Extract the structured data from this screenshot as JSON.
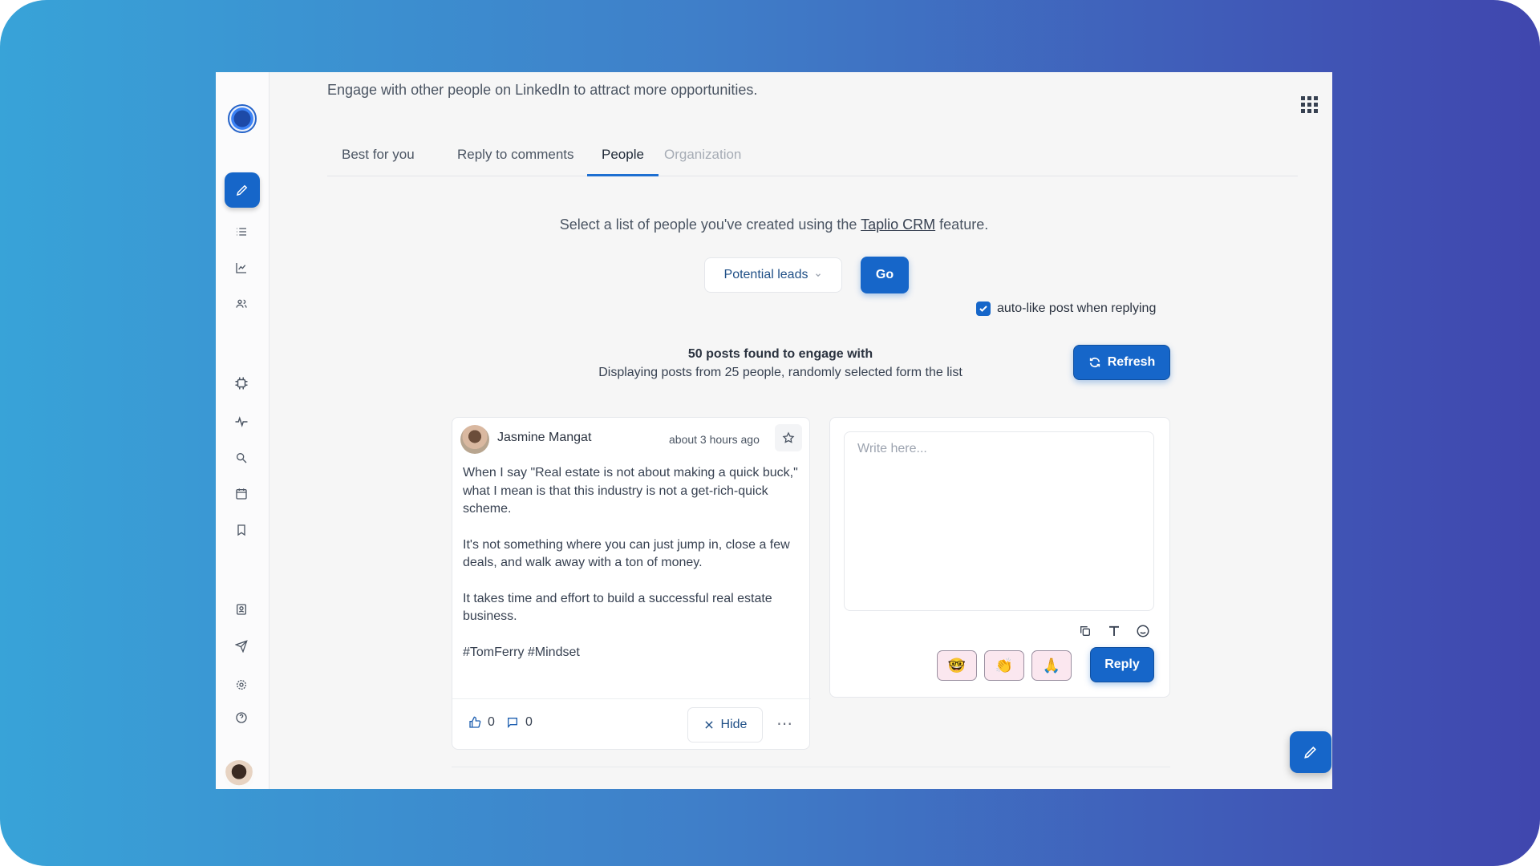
{
  "header": {
    "subtitle": "Engage with other people on LinkedIn to attract more opportunities."
  },
  "tabs": [
    {
      "label": "Best for you"
    },
    {
      "label": "Reply to comments"
    },
    {
      "label": "People",
      "active": true
    },
    {
      "label": "Organization",
      "disabled": true
    }
  ],
  "people": {
    "helper_prefix": "Select a list of people you've created using the",
    "helper_link": "Taplio CRM",
    "helper_suffix": "feature.",
    "selected_list": "Potential leads",
    "go_label": "Go",
    "autolike_label": "auto-like post when replying",
    "autolike_checked": true,
    "found_title": "50 posts found to engage with",
    "found_sub": "Displaying posts from 25 people, randomly selected form the list",
    "refresh_label": "Refresh"
  },
  "post": {
    "author": "Jasmine Mangat",
    "time": "about 3 hours ago",
    "paragraphs": [
      "When I say \"Real estate is not about making a quick buck,\" what I mean is that this industry is not a get-rich-quick scheme.",
      "It's not something where you can just jump in, close a few deals, and walk away with a ton of money.",
      "It takes time and effort to build a successful real estate business.",
      "#TomFerry #Mindset"
    ],
    "likes": "0",
    "comments": "0",
    "hide_label": "Hide"
  },
  "reply": {
    "placeholder": "Write here...",
    "emojis": [
      "🤓",
      "👏",
      "🙏"
    ],
    "reply_label": "Reply"
  },
  "colors": {
    "accent": "#1666c9",
    "gradient_start": "#38a3d8",
    "gradient_end": "#4046ae"
  },
  "sidebar_icons": [
    "list-icon",
    "chart-icon",
    "people-icon",
    "ai-chip-icon",
    "pulse-icon",
    "search-icon",
    "calendar-icon",
    "bookmark-icon",
    "contacts-icon",
    "send-icon",
    "settings-icon",
    "help-icon"
  ]
}
